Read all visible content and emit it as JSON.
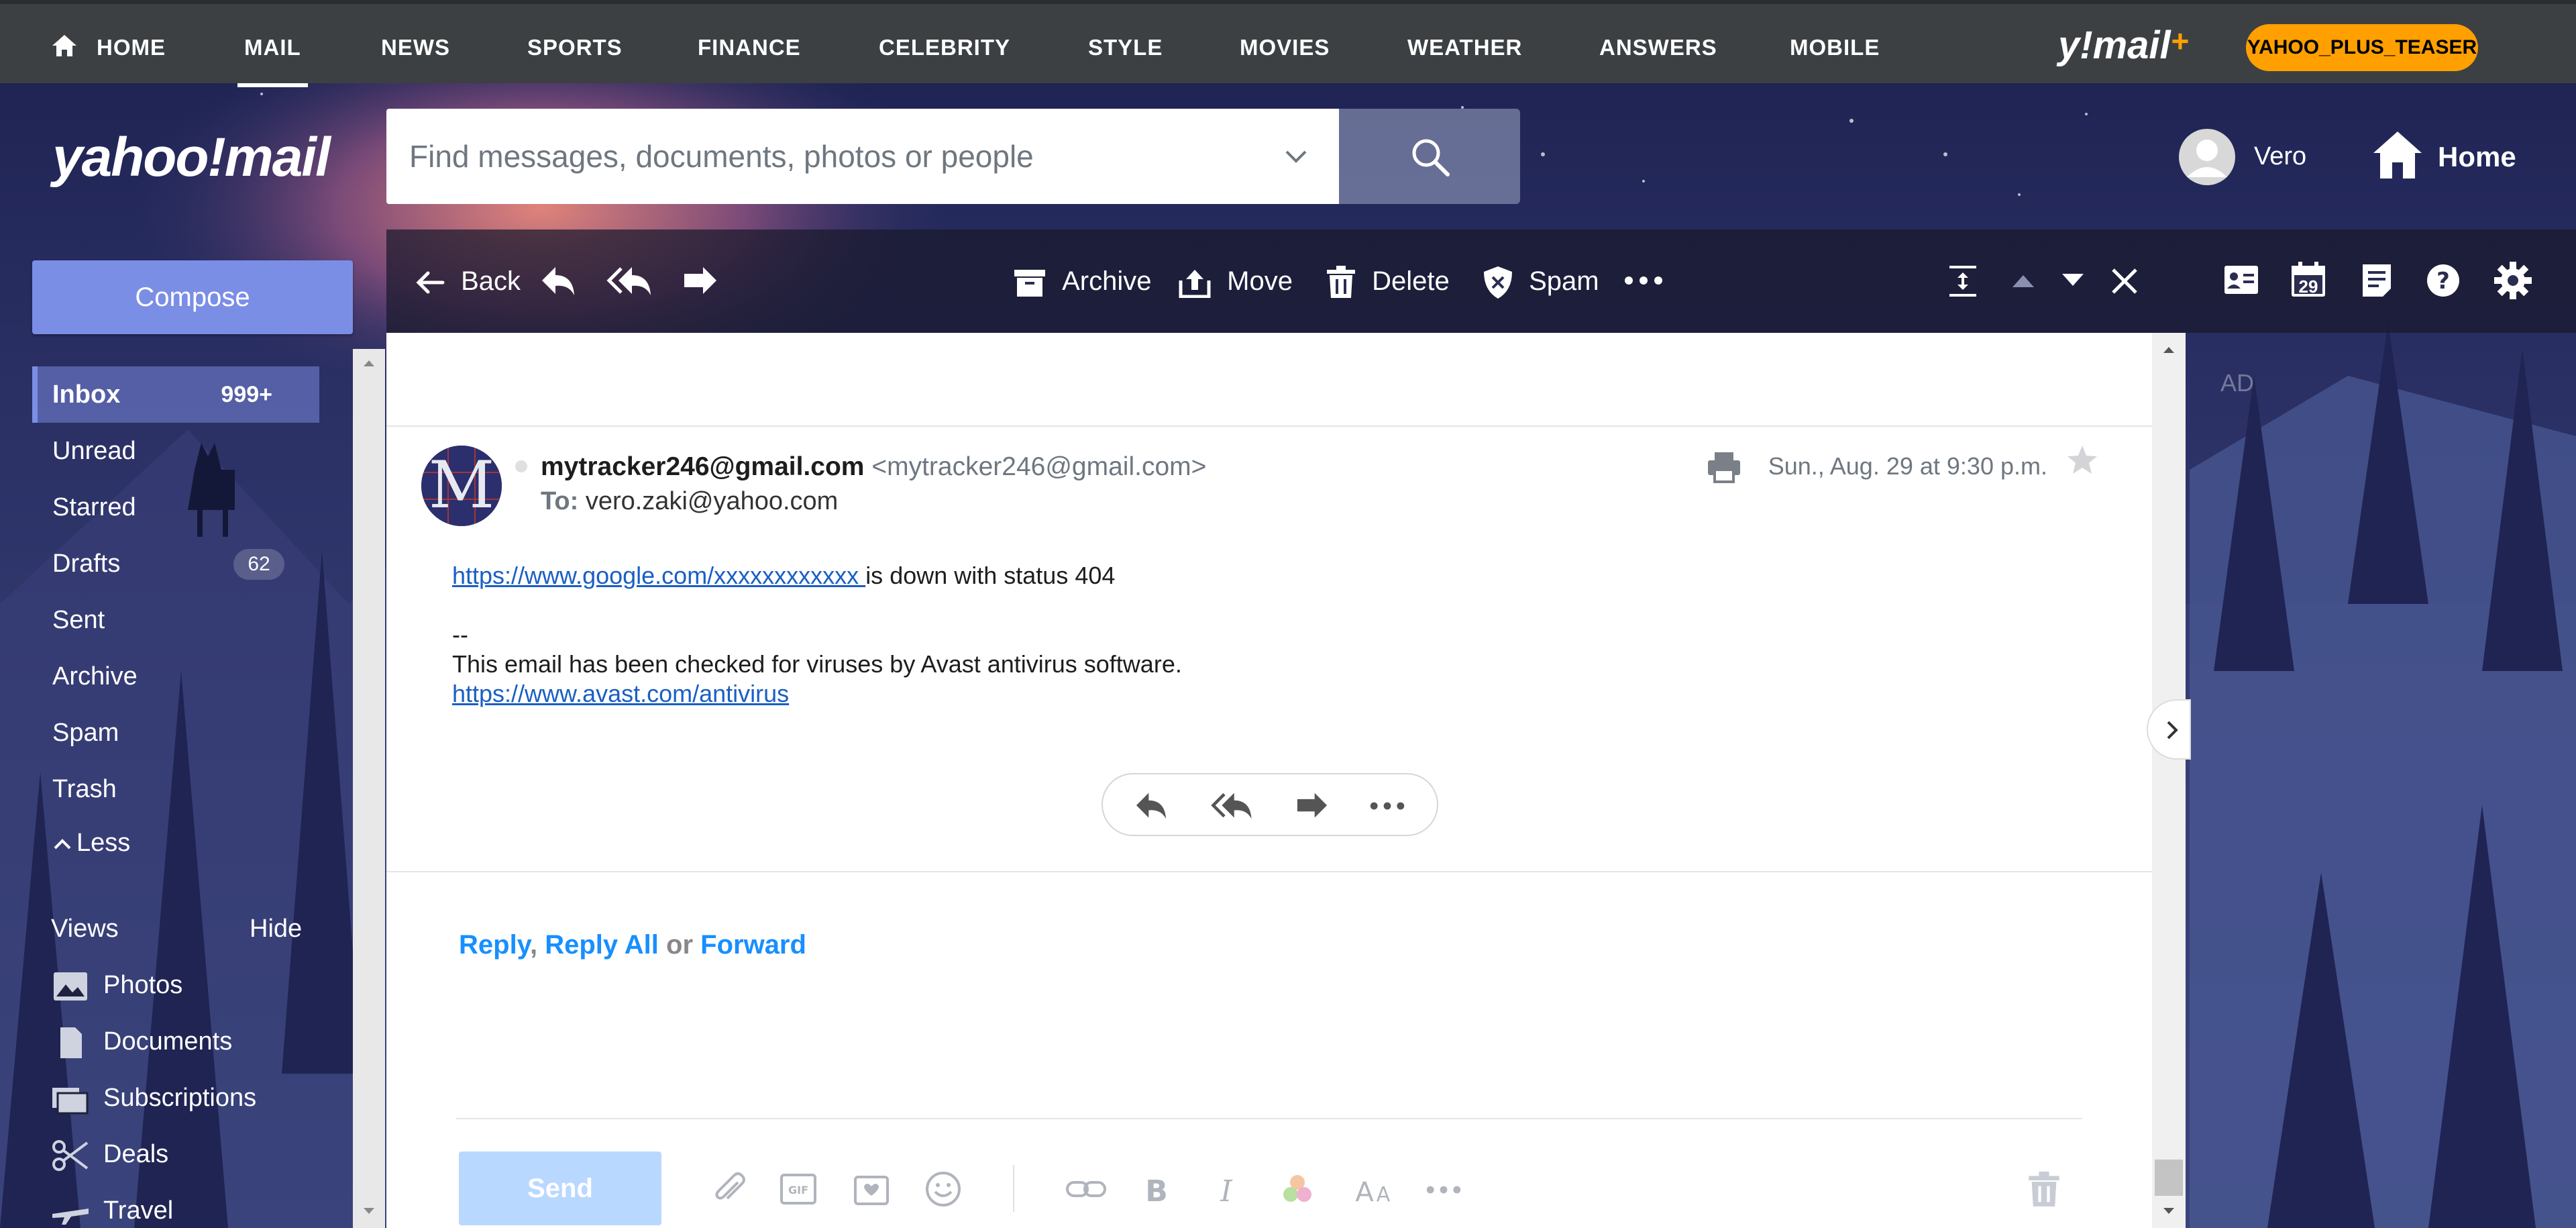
{
  "topnav": {
    "items": [
      "HOME",
      "MAIL",
      "NEWS",
      "SPORTS",
      "FINANCE",
      "CELEBRITY",
      "STYLE",
      "MOVIES",
      "WEATHER",
      "ANSWERS",
      "MOBILE"
    ],
    "active": "MAIL",
    "ymail_logo": "y!mail",
    "ymail_plus": "+",
    "teaser_label": "YAHOO_PLUS_TEASER"
  },
  "header": {
    "logo": "yahoo!mail",
    "search_placeholder": "Find messages, documents, photos or people",
    "user_name": "Vero",
    "home_label": "Home"
  },
  "sidebar": {
    "compose_label": "Compose",
    "folders": [
      {
        "label": "Inbox",
        "count": "999+"
      },
      {
        "label": "Unread"
      },
      {
        "label": "Starred"
      },
      {
        "label": "Drafts",
        "count": "62"
      },
      {
        "label": "Sent"
      },
      {
        "label": "Archive"
      },
      {
        "label": "Spam"
      },
      {
        "label": "Trash"
      }
    ],
    "less_label": "Less",
    "views_label": "Views",
    "hide_label": "Hide",
    "views": [
      {
        "label": "Photos",
        "icon": "photo-icon"
      },
      {
        "label": "Documents",
        "icon": "document-icon"
      },
      {
        "label": "Subscriptions",
        "icon": "subscriptions-icon"
      },
      {
        "label": "Deals",
        "icon": "scissors-icon"
      },
      {
        "label": "Travel",
        "icon": "plane-icon"
      }
    ]
  },
  "toolbar": {
    "back_label": "Back",
    "archive_label": "Archive",
    "move_label": "Move",
    "delete_label": "Delete",
    "spam_label": "Spam",
    "calendar_day": "29"
  },
  "message": {
    "from_name": "mytracker246@gmail.com",
    "from_address": "<mytracker246@gmail.com>",
    "to_label": "To:",
    "to_address": "vero.zaki@yahoo.com",
    "date": "Sun., Aug. 29 at 9:30 p.m.",
    "avatar_letter": "M",
    "body_link": "https://www.google.com/xxxxxxxxxxxx ",
    "body_text": "is down with status 404",
    "sig_dash": "--",
    "sig_text": "This email has been checked for viruses by Avast antivirus software.",
    "sig_link": "https://www.avast.com/antivirus"
  },
  "reply": {
    "reply_label": "Reply",
    "comma": ",",
    "reply_all_label": "Reply All",
    "or_label": "or",
    "forward_label": "Forward",
    "send_label": "Send"
  },
  "rail": {
    "ad_label": "AD"
  },
  "colors": {
    "topnav_bg": "#3c4043",
    "accent": "#7b8ee6",
    "teaser": "#ffa000",
    "link": "#188fff"
  }
}
